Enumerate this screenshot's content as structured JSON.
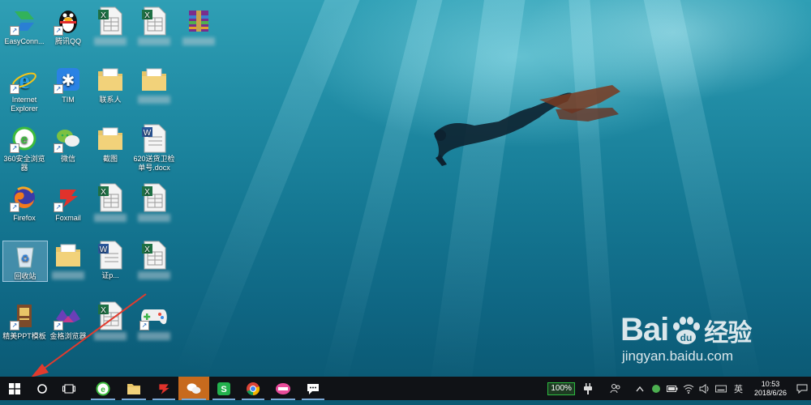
{
  "desktop": {
    "icons": [
      {
        "label": "EasyConn...",
        "icon": "easyconnect-icon"
      },
      {
        "label": "腾讯QQ",
        "icon": "qq-penguin-icon"
      },
      {
        "label": "",
        "icon": "excel-file-icon"
      },
      {
        "label": "",
        "icon": "excel-file-icon"
      },
      {
        "label": "",
        "icon": "winrar-archive-icon"
      },
      {
        "label": "Internet Explorer",
        "icon": "internet-explorer-icon"
      },
      {
        "label": "TIM",
        "icon": "tim-icon"
      },
      {
        "label": "联系人",
        "icon": "folder-icon"
      },
      {
        "label": "",
        "icon": "folder-icon"
      },
      {
        "label": "360安全浏览器",
        "icon": "360-browser-icon"
      },
      {
        "label": "微信",
        "icon": "wechat-icon"
      },
      {
        "label": "截图",
        "icon": "folder-icon"
      },
      {
        "label": "620送货卫检单号.docx",
        "icon": "word-file-icon"
      },
      {
        "label": "Firefox",
        "icon": "firefox-icon"
      },
      {
        "label": "Foxmail",
        "icon": "foxmail-icon"
      },
      {
        "label": "",
        "icon": "excel-file-icon"
      },
      {
        "label": "",
        "icon": "excel-file-icon"
      },
      {
        "label": "回收站",
        "icon": "recycle-bin-icon"
      },
      {
        "label": "",
        "icon": "folder-icon"
      },
      {
        "label": "证p...",
        "icon": "word-file-icon"
      },
      {
        "label": "",
        "icon": "excel-file-icon"
      },
      {
        "label": "精美PPT模板",
        "icon": "ppt-template-icon"
      },
      {
        "label": "金格浏览器",
        "icon": "kinggrid-browser-icon"
      },
      {
        "label": "",
        "icon": "excel-file-icon"
      },
      {
        "label": "",
        "icon": "game-controller-icon"
      }
    ]
  },
  "taskbar": {
    "pinned": [
      {
        "icon": "start-windows-icon"
      },
      {
        "icon": "cortana-search-icon"
      },
      {
        "icon": "task-view-icon"
      },
      {
        "icon": "360-browser-icon"
      },
      {
        "icon": "file-explorer-icon"
      },
      {
        "icon": "foxmail-icon"
      },
      {
        "icon": "wechat-icon"
      },
      {
        "icon": "wps-spreadsheet-icon"
      },
      {
        "icon": "chrome-icon"
      },
      {
        "icon": "picture-app-icon"
      },
      {
        "icon": "chat-app-icon"
      }
    ],
    "tray": {
      "battery_percent": "100%",
      "input_method": "英",
      "time": "10:53",
      "date": "2018/6/26"
    }
  },
  "watermark": {
    "brand": "Bai",
    "brand_suffix": "经验",
    "url": "jingyan.baidu.com"
  },
  "colors": {
    "taskbar_bg": "#101216",
    "highlight": "#c76a1d",
    "annotation_arrow": "#e23b2e",
    "battery_green": "#2dbb3f"
  }
}
